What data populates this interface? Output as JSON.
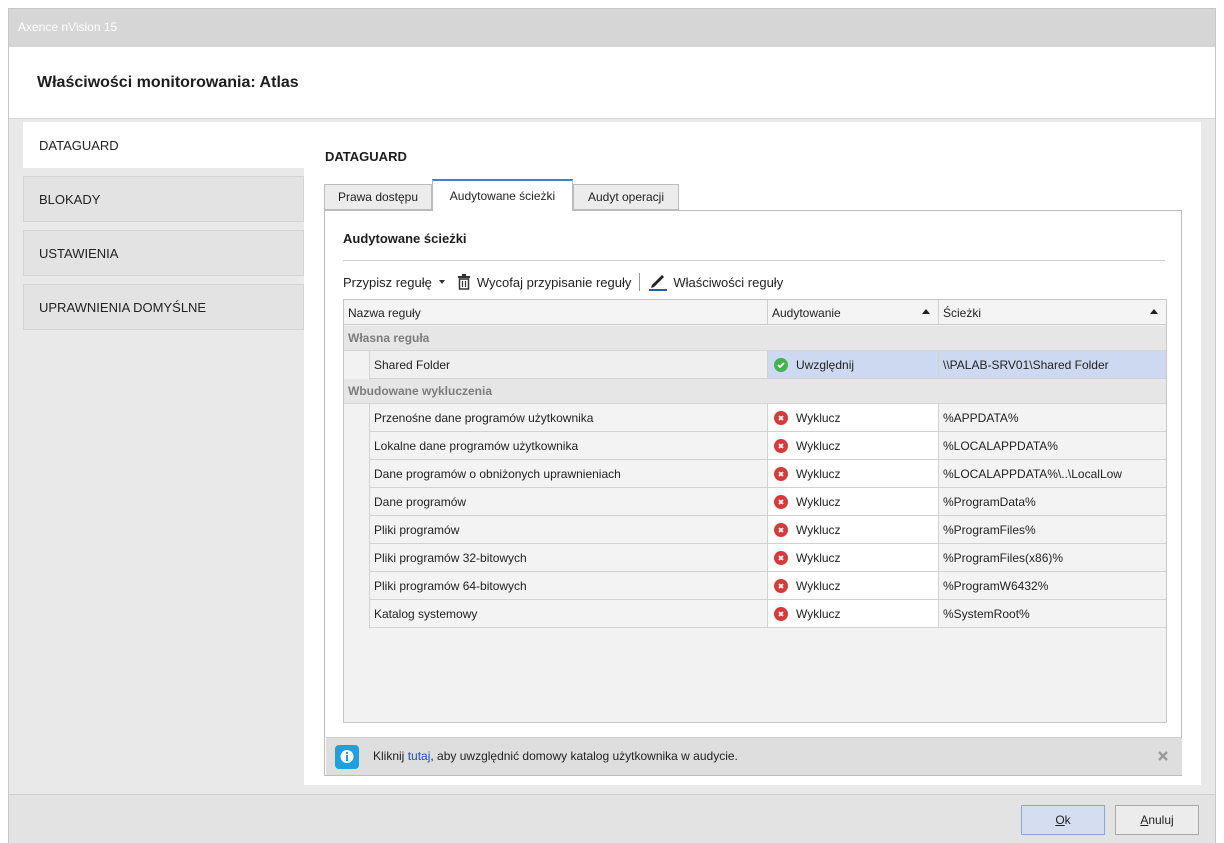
{
  "window": {
    "app_title": "Axence nVision 15",
    "dialog_title": "Właściwości monitorowania: Atlas"
  },
  "sidebar": {
    "items": [
      {
        "label": "DATAGUARD",
        "active": true
      },
      {
        "label": "BLOKADY",
        "active": false
      },
      {
        "label": "USTAWIENIA",
        "active": false
      },
      {
        "label": "UPRAWNIENIA DOMYŚLNE",
        "active": false
      }
    ]
  },
  "main": {
    "section_title": "DATAGUARD",
    "tabs": [
      {
        "label": "Prawa dostępu",
        "active": false
      },
      {
        "label": "Audytowane ścieżki",
        "active": true
      },
      {
        "label": "Audyt operacji",
        "active": false
      }
    ],
    "panel_title": "Audytowane ścieżki",
    "toolbar": {
      "assign_rule": "Przypisz regułę",
      "revoke_rule": "Wycofaj przypisanie reguły",
      "rule_properties": "Właściwości reguły"
    },
    "grid": {
      "columns": [
        "Nazwa reguły",
        "Audytowanie",
        "Ścieżki"
      ],
      "groups": [
        {
          "label": "Własna reguła",
          "rows": [
            {
              "name": "Shared Folder",
              "status": "Uwzględnij",
              "status_type": "include",
              "path": "\\\\PALAB-SRV01\\Shared Folder",
              "selected": true
            }
          ]
        },
        {
          "label": "Wbudowane wykluczenia",
          "rows": [
            {
              "name": "Przenośne dane programów użytkownika",
              "status": "Wyklucz",
              "status_type": "exclude",
              "path": "%APPDATA%"
            },
            {
              "name": "Lokalne dane programów użytkownika",
              "status": "Wyklucz",
              "status_type": "exclude",
              "path": "%LOCALAPPDATA%"
            },
            {
              "name": "Dane programów o obniżonych uprawnieniach",
              "status": "Wyklucz",
              "status_type": "exclude",
              "path": "%LOCALAPPDATA%\\..\\LocalLow"
            },
            {
              "name": "Dane programów",
              "status": "Wyklucz",
              "status_type": "exclude",
              "path": "%ProgramData%"
            },
            {
              "name": "Pliki programów",
              "status": "Wyklucz",
              "status_type": "exclude",
              "path": "%ProgramFiles%"
            },
            {
              "name": "Pliki programów 32-bitowych",
              "status": "Wyklucz",
              "status_type": "exclude",
              "path": "%ProgramFiles(x86)%"
            },
            {
              "name": "Pliki programów 64-bitowych",
              "status": "Wyklucz",
              "status_type": "exclude",
              "path": "%ProgramW6432%"
            },
            {
              "name": "Katalog systemowy",
              "status": "Wyklucz",
              "status_type": "exclude",
              "path": "%SystemRoot%"
            }
          ]
        }
      ]
    },
    "info": {
      "prefix": "Kliknij ",
      "link": "tutaj",
      "suffix": ", aby uwzględnić domowy katalog użytkownika w audycie."
    }
  },
  "footer": {
    "ok_mnemonic": "O",
    "ok_rest": "k",
    "cancel_mnemonic": "A",
    "cancel_rest": "nuluj"
  },
  "colors": {
    "accent": "#3f82c8",
    "selected_row": "#cdd9f1",
    "include": "#41b54a",
    "exclude": "#d83a3a",
    "info": "#1ea0e0"
  }
}
